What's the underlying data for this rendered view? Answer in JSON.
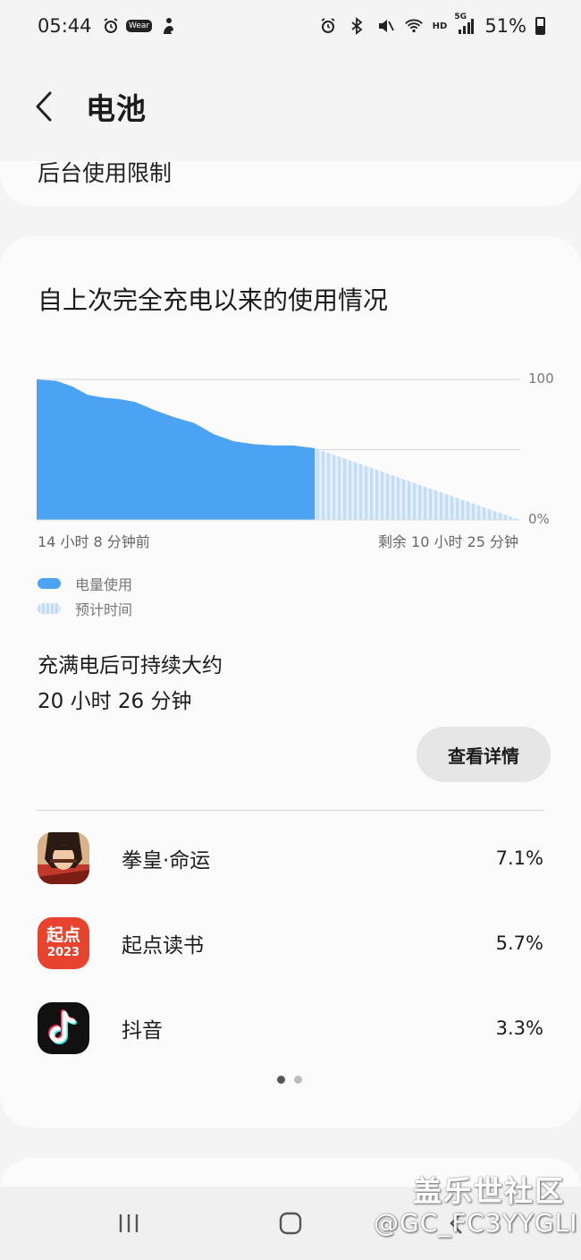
{
  "status_bar": {
    "time": "05:44",
    "wear_label": "Wear",
    "hd_label": "HD",
    "network_label": "5G",
    "battery_percent": "51%",
    "battery_level": 0.51,
    "icons": [
      "alarm-icon",
      "wear-icon",
      "person-icon",
      "alarm-icon",
      "bluetooth-icon",
      "mute-icon",
      "wifi-icon",
      "signal-icon",
      "battery-icon"
    ]
  },
  "header": {
    "back_icon": "chevron-left-icon",
    "title": "电池"
  },
  "prev_card": {
    "text": "后台使用限制"
  },
  "usage_card": {
    "title": "自上次完全充电以来的使用情况",
    "legend": {
      "used": "电量使用",
      "estimated": "预计时间"
    },
    "estimate_label": "充满电后可持续大约",
    "estimate_value": "20 小时 26 分钟",
    "details_button": "查看详情"
  },
  "chart_data": {
    "type": "area",
    "title": "",
    "xlabel": "",
    "ylabel": "",
    "x_start_label": "14 小时 8 分钟前",
    "x_end_label": "剩余 10 小时 25 分钟",
    "y_tick_labels": [
      "100",
      "0%"
    ],
    "ylim": [
      0,
      100
    ],
    "grid": true,
    "series": [
      {
        "name": "电量使用",
        "x_hours": [
          0,
          1.0,
          1.8,
          2.6,
          3.4,
          4.2,
          5.0,
          6.0,
          7.0,
          8.0,
          9.0,
          10.0,
          11.0,
          12.0,
          13.0,
          14.13
        ],
        "values": [
          100,
          99,
          95,
          89,
          87,
          86,
          84,
          78,
          73,
          69,
          61,
          56,
          54,
          53,
          53,
          51
        ]
      },
      {
        "name": "预计时间",
        "x_hours": [
          14.13,
          24.55
        ],
        "values": [
          51,
          0
        ]
      }
    ]
  },
  "apps": [
    {
      "name": "拳皇·命运",
      "percent": "7.1%",
      "icon": "kof-destiny-app-icon"
    },
    {
      "name": "起点读书",
      "percent": "5.7%",
      "icon": "qidian-app-icon",
      "icon_text": "起点",
      "icon_sub": "2023"
    },
    {
      "name": "抖音",
      "percent": "3.3%",
      "icon": "douyin-app-icon"
    }
  ],
  "pager": {
    "count": 2,
    "active": 0
  },
  "colors": {
    "used": "#4da3f3",
    "estimated": "#c4dcf5",
    "qidian_red": "#e8432f",
    "douyin_black": "#111111"
  },
  "nav_bar": {
    "icons": [
      "recent-apps-icon",
      "home-icon",
      "back-icon"
    ]
  },
  "watermark": {
    "line1": "盖乐世社区",
    "line2": "@GC_FC3YYGLI"
  }
}
